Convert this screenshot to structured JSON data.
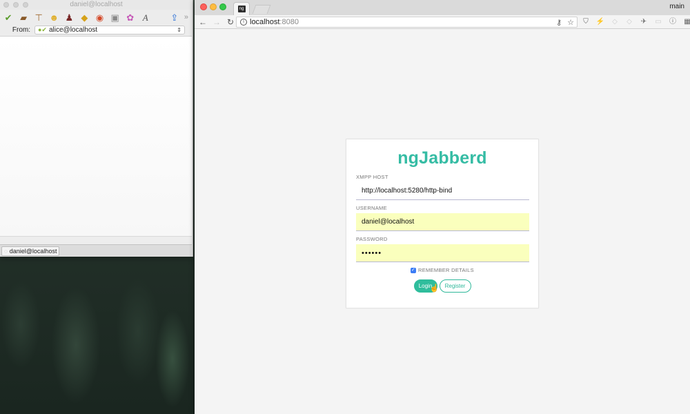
{
  "mail": {
    "title": "daniel@localhost",
    "from_label": "From:",
    "from_value": "alice@localhost",
    "tab_label": "daniel@localhost",
    "toolbar_icons": [
      "app-icon",
      "briefcase-icon",
      "signpost-icon",
      "emoji-icon",
      "person-icon",
      "warning-icon",
      "chrome-icon",
      "image-icon",
      "color-wheel-icon",
      "font-icon",
      "upload-icon"
    ]
  },
  "browser": {
    "profile": "main",
    "url_host": "localhost",
    "url_port": ":8080",
    "favicon_text": "ng"
  },
  "login": {
    "brand": "ngJabberd",
    "host_label": "XMPP HOST",
    "host_value": "http://localhost:5280/http-bind",
    "username_label": "USERNAME",
    "username_value": "daniel@localhost",
    "password_label": "PASSWORD",
    "password_value": "••••••",
    "remember_label": "REMEMBER DETAILS",
    "remember_checked": true,
    "login_button": "Login",
    "register_button": "Register",
    "accent_color": "#35bca4",
    "autofill_color": "#faffbd"
  }
}
